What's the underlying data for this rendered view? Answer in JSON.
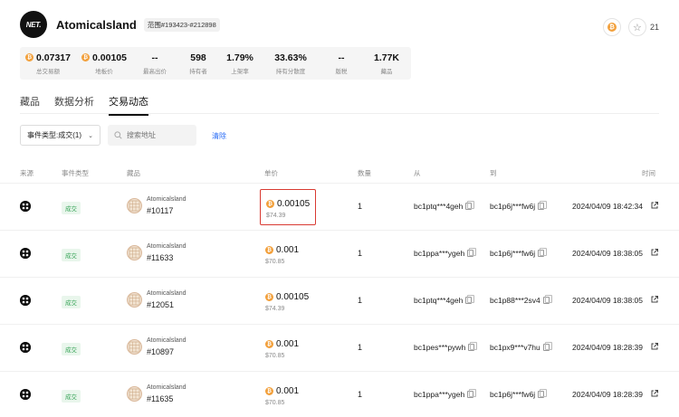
{
  "header": {
    "logo_text": "NET.",
    "title": "Atomicalsland",
    "range_badge": "范围#193423-#212898",
    "star_count": "21"
  },
  "stats": [
    {
      "value": "0.07317",
      "label": "总交易额",
      "btc": true
    },
    {
      "value": "0.00105",
      "label": "地板价",
      "btc": true
    },
    {
      "value": "--",
      "label": "最高出价",
      "btc": false
    },
    {
      "value": "598",
      "label": "持有者",
      "btc": false
    },
    {
      "value": "1.79%",
      "label": "上架率",
      "btc": false
    },
    {
      "value": "33.63%",
      "label": "持有分散度",
      "btc": false
    },
    {
      "value": "--",
      "label": "版税",
      "btc": false
    },
    {
      "value": "1.77K",
      "label": "藏品",
      "btc": false
    }
  ],
  "tabs": [
    "藏品",
    "数据分析",
    "交易动态"
  ],
  "active_tab": "交易动态",
  "filters": {
    "event_select": "事件类型:成交(1)",
    "search_placeholder": "搜索地址",
    "clear_label": "清除"
  },
  "table": {
    "headers": {
      "source": "来源",
      "event": "事件类型",
      "item": "藏品",
      "price": "单价",
      "qty": "数量",
      "from": "从",
      "to": "到",
      "time": "时间"
    },
    "rows": [
      {
        "event": "成交",
        "collection": "Atomicalsland",
        "item_id": "#10117",
        "price": "0.00105",
        "usd": "$74.39",
        "qty": "1",
        "from": "bc1ptq***4geh",
        "to": "bc1p6j***fw6j",
        "time": "2024/04/09 18:42:34",
        "highlighted": true
      },
      {
        "event": "成交",
        "collection": "Atomicalsland",
        "item_id": "#11633",
        "price": "0.001",
        "usd": "$70.85",
        "qty": "1",
        "from": "bc1ppa***ygeh",
        "to": "bc1p6j***fw6j",
        "time": "2024/04/09 18:38:05",
        "highlighted": false
      },
      {
        "event": "成交",
        "collection": "Atomicalsland",
        "item_id": "#12051",
        "price": "0.00105",
        "usd": "$74.39",
        "qty": "1",
        "from": "bc1ptq***4geh",
        "to": "bc1p88***2sv4",
        "time": "2024/04/09 18:38:05",
        "highlighted": false
      },
      {
        "event": "成交",
        "collection": "Atomicalsland",
        "item_id": "#10897",
        "price": "0.001",
        "usd": "$70.85",
        "qty": "1",
        "from": "bc1pes***pywh",
        "to": "bc1px9***v7hu",
        "time": "2024/04/09 18:28:39",
        "highlighted": false
      },
      {
        "event": "成交",
        "collection": "Atomicalsland",
        "item_id": "#11635",
        "price": "0.001",
        "usd": "$70.85",
        "qty": "1",
        "from": "bc1ppa***ygeh",
        "to": "bc1p6j***fw6j",
        "time": "2024/04/09 18:28:39",
        "highlighted": false
      }
    ]
  },
  "colors": {
    "btc": "#f2a03c",
    "highlight_border": "#d93a32",
    "event_badge_bg": "#e9f6ec",
    "event_badge_text": "#3aa55a",
    "link": "#2a6cf6"
  }
}
